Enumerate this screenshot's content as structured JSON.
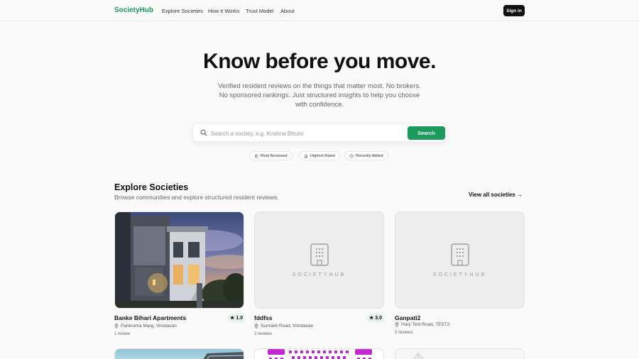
{
  "nav": {
    "logo": "SocietyHub",
    "links": [
      "Explore Societies",
      "How It Works",
      "Trust Model",
      "About"
    ],
    "signin": "Sign in"
  },
  "hero": {
    "title": "Know before you move.",
    "subtitle": "Verified resident reviews on the things that matter most. No brokers. No sponsored rankings. Just structured insights to help you choose with confidence."
  },
  "search": {
    "placeholder": "Search a society, e.g. Krishna Bhumi",
    "value": "",
    "button": "Search"
  },
  "filters": [
    {
      "label": "Most Reviewed",
      "icon": "flame-icon"
    },
    {
      "label": "Highest Rated",
      "icon": "award-icon"
    },
    {
      "label": "Recently Added",
      "icon": "clock-icon"
    }
  ],
  "section": {
    "title": "Explore Societies",
    "subtitle": "Browse communities and explore structured resident reviews.",
    "view_all": "View all societies →"
  },
  "cards": [
    {
      "name": "Banke Bihari Apartments",
      "location": "Parikrama Marg, Vrindavan",
      "reviews": "1 review",
      "rating": "1.0",
      "image": "photo"
    },
    {
      "name": "fddfss",
      "location": "Sunrakh Road, Vrindavan",
      "reviews": "2 reviews",
      "rating": "3.0",
      "image": "placeholder",
      "placeholder_text": "SOCIETYHUB"
    },
    {
      "name": "Ganpati2",
      "location": "Hary Test Road, TEST2",
      "reviews": "0 reviews",
      "rating": "",
      "image": "placeholder",
      "placeholder_text": "SOCIETYHUB"
    }
  ],
  "colors": {
    "brand": "#1a9a5c",
    "rating_bg": "#e7f4ec",
    "dark": "#111111"
  }
}
